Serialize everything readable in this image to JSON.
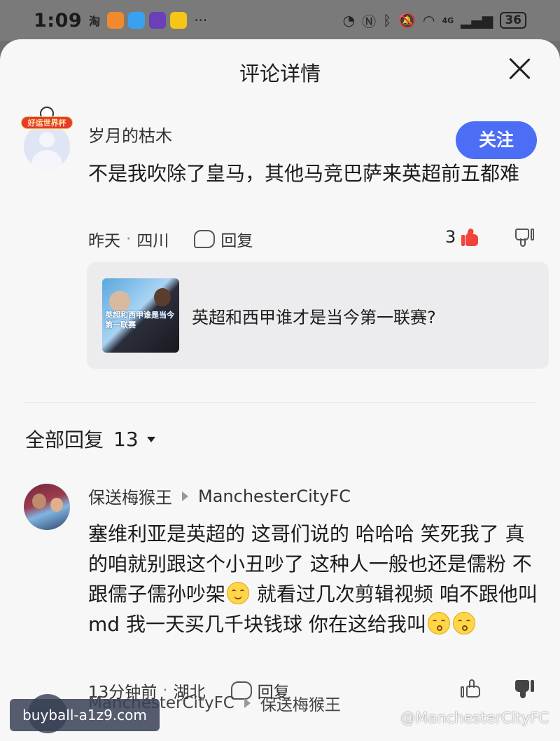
{
  "status_bar": {
    "time": "1:09",
    "taobao_icon_label": "淘",
    "more": "···",
    "network": "4G",
    "battery": "36"
  },
  "sheet": {
    "title": "评论详情"
  },
  "top_comment": {
    "badge_text": "好运世界杯",
    "username": "岁月的枯木",
    "follow_label": "关注",
    "content": "不是我吹除了皇马，其他马竞巴萨来英超前五都难",
    "time": "昨天",
    "location": "四川",
    "reply_label": "回复",
    "like_count": "3"
  },
  "topic": {
    "thumb_text": "英超和西甲谁是当今第一联赛",
    "title": "英超和西甲谁才是当今第一联赛?"
  },
  "all_replies": {
    "label": "全部回复",
    "count": "13"
  },
  "reply_comment": {
    "username": "保送梅猴王",
    "reply_to": "ManchesterCityFC",
    "content_part1": "塞维利亚是英超的 这哥们说的 哈哈哈 笑死我了 真的咱就别跟这个小丑吵了 这种人一般也还是儒粉 不跟儒子儒孙吵架",
    "content_part2": " 就看过几次剪辑视频 咱不跟他叫 md 我一天买几千块钱球 你在这给我叫",
    "time": "13分钟前",
    "location": "湖北",
    "reply_label": "回复"
  },
  "next_reply": {
    "username": "ManchesterCityFC",
    "reply_to": "保送梅猴王"
  },
  "watermarks": {
    "left": "buyball-a1z9.com",
    "right": "@ManchesterCityFC"
  },
  "colors": {
    "accent": "#4c6ef5",
    "like_active": "#f1443a"
  }
}
